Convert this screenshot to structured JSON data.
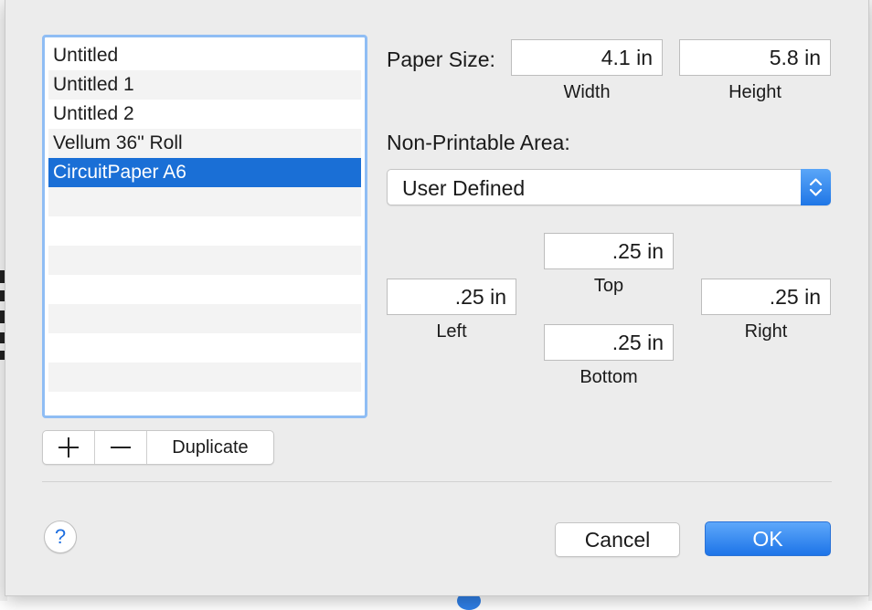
{
  "paper_list": {
    "items": [
      {
        "label": "Untitled",
        "selected": false
      },
      {
        "label": "Untitled 1",
        "selected": false
      },
      {
        "label": "Untitled 2",
        "selected": false
      },
      {
        "label": "Vellum 36\" Roll",
        "selected": false
      },
      {
        "label": "CircuitPaper A6",
        "selected": true
      }
    ],
    "empty_rows": 8
  },
  "list_buttons": {
    "add_icon": "plus-icon",
    "remove_icon": "minus-icon",
    "duplicate_label": "Duplicate"
  },
  "paper_size": {
    "label": "Paper Size:",
    "width_value": "4.1 in",
    "width_label": "Width",
    "height_value": "5.8 in",
    "height_label": "Height"
  },
  "non_printable": {
    "label": "Non-Printable Area:",
    "selected_option": "User Defined",
    "top_value": ".25 in",
    "top_label": "Top",
    "left_value": ".25 in",
    "left_label": "Left",
    "right_value": ".25 in",
    "right_label": "Right",
    "bottom_value": ".25 in",
    "bottom_label": "Bottom"
  },
  "footer": {
    "help_label": "?",
    "cancel_label": "Cancel",
    "ok_label": "OK"
  },
  "colors": {
    "accent": "#1a6fd6",
    "list_focus_ring": "#8fbdf4",
    "sheet_background": "#ececec"
  }
}
